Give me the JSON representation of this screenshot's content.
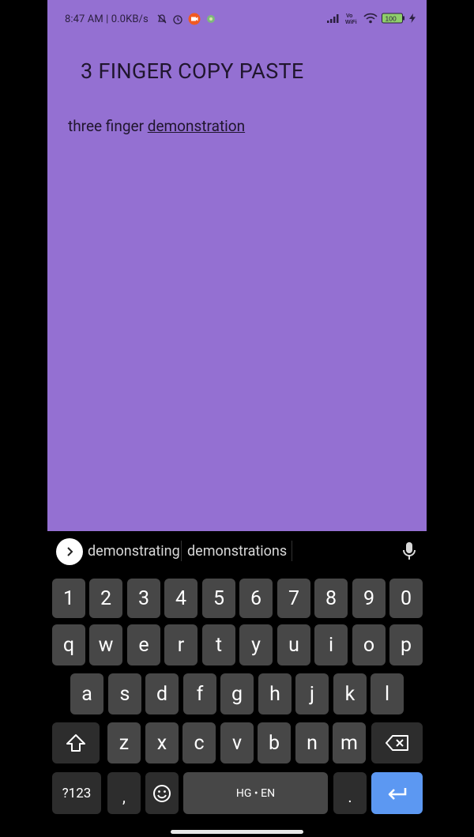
{
  "status": {
    "time": "8:47 AM | 0.0KB/s",
    "battery": "100"
  },
  "app": {
    "title": "3 FINGER COPY PASTE",
    "text_plain": "three finger ",
    "text_composing": "demonstration"
  },
  "keyboard": {
    "suggestions": [
      "demonstrating",
      "demonstrations"
    ],
    "row_numbers": [
      "1",
      "2",
      "3",
      "4",
      "5",
      "6",
      "7",
      "8",
      "9",
      "0"
    ],
    "row_top": [
      "q",
      "w",
      "e",
      "r",
      "t",
      "y",
      "u",
      "i",
      "o",
      "p"
    ],
    "row_mid": [
      "a",
      "s",
      "d",
      "f",
      "g",
      "h",
      "j",
      "k",
      "l"
    ],
    "row_bottom": [
      "z",
      "x",
      "c",
      "v",
      "b",
      "n",
      "m"
    ],
    "symbols_label": "?123",
    "comma_label": ",",
    "space_label": "HG • EN",
    "period_label": "."
  }
}
